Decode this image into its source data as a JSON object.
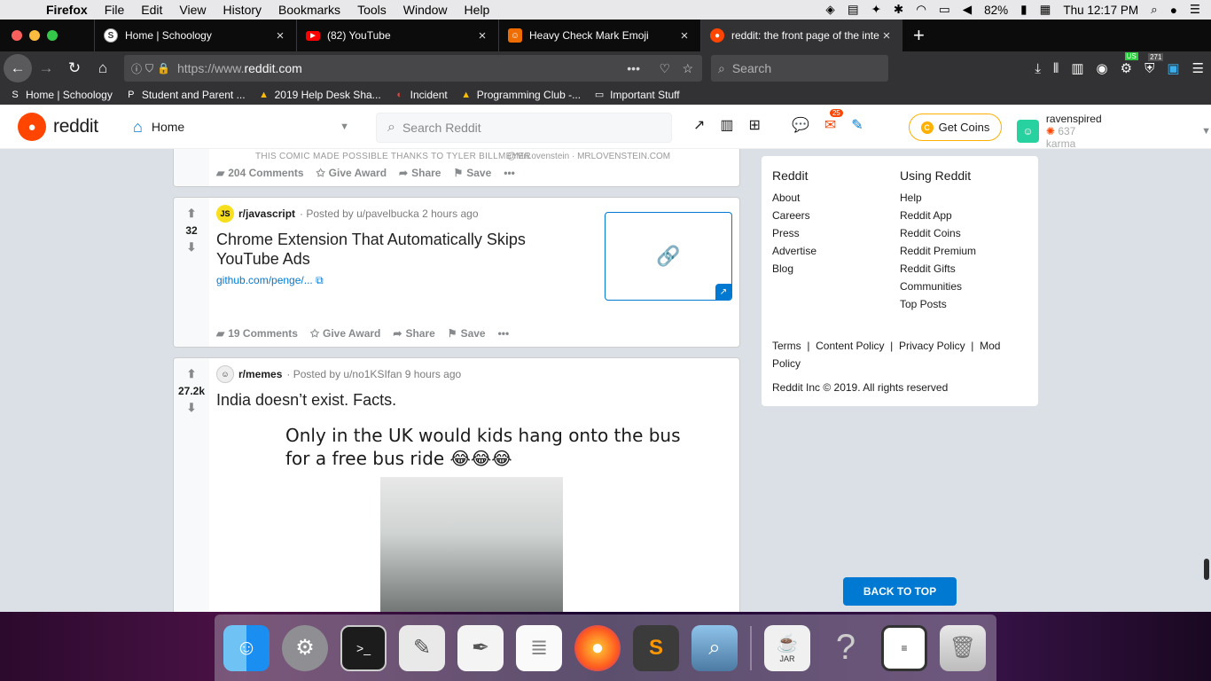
{
  "menubar": {
    "app": "Firefox",
    "items": [
      "File",
      "Edit",
      "View",
      "History",
      "Bookmarks",
      "Tools",
      "Window",
      "Help"
    ],
    "battery": "82%",
    "clock": "Thu 12:17 PM"
  },
  "tabs": [
    {
      "title": "Home | Schoology",
      "icon": "schoology-icon"
    },
    {
      "title": "(82) YouTube",
      "icon": "youtube-icon"
    },
    {
      "title": "Heavy Check Mark Emoji",
      "icon": "emojipedia-icon"
    },
    {
      "title": "reddit: the front page of the internet",
      "icon": "reddit-icon"
    }
  ],
  "nav": {
    "url_prefix": "https://www.",
    "url_domain": "reddit.com",
    "search_placeholder": "Search",
    "badge_271": "271",
    "badge_us": "US"
  },
  "bookmarks": [
    {
      "label": "Home | Schoology",
      "icon": "S"
    },
    {
      "label": "Student and Parent ...",
      "icon": "P"
    },
    {
      "label": "2019 Help Desk Sha...",
      "icon": "▲"
    },
    {
      "label": "Incident",
      "icon": "◐"
    },
    {
      "label": "Programming Club -...",
      "icon": "▲"
    },
    {
      "label": "Important Stuff",
      "icon": "▭"
    }
  ],
  "reddit_header": {
    "logo_text": "reddit",
    "feed": "Home",
    "search_placeholder": "Search Reddit",
    "mail_badge": "25",
    "get_coins": "Get Coins",
    "username": "ravenspired",
    "karma": "637 karma"
  },
  "posts": [
    {
      "partial_caption": "THIS COMIC MADE POSSIBLE THANKS TO TYLER BILLMEYER",
      "partial_credit": "@MrLovenstein · MRLOVENSTEIN.COM",
      "comments": "204 Comments",
      "award": "Give Award",
      "share": "Share",
      "save": "Save"
    },
    {
      "votes": "32",
      "sub_icon": "JS",
      "subreddit": "r/javascript",
      "posted_by": "· Posted by u/pavelbucka 2 hours ago",
      "title": "Chrome Extension That Automatically Skips YouTube Ads",
      "link": "github.com/penge/...",
      "comments": "19 Comments",
      "award": "Give Award",
      "share": "Share",
      "save": "Save"
    },
    {
      "votes": "27.2k",
      "subreddit": "r/memes",
      "posted_by": "· Posted by u/no1KSIfan 9 hours ago",
      "title": "India doesn’t exist. Facts.",
      "meme_line1": "Only in the UK would kids hang onto the bus",
      "meme_line2": "for a free bus ride 😂😂😂"
    }
  ],
  "sidebar": {
    "col1_title": "Reddit",
    "col1": [
      "About",
      "Careers",
      "Press",
      "Advertise",
      "Blog"
    ],
    "col2_title": "Using Reddit",
    "col2": [
      "Help",
      "Reddit App",
      "Reddit Coins",
      "Reddit Premium",
      "Reddit Gifts",
      "Communities",
      "Top Posts"
    ],
    "legal": "Terms  |  Content Policy  |  Privacy Policy  |  Mod Policy",
    "copyright": "Reddit Inc © 2019. All rights reserved"
  },
  "back_to_top": "BACK TO TOP",
  "dock": [
    "finder-icon",
    "system-preferences-icon",
    "terminal-icon",
    "script-editor-icon",
    "textedit-icon",
    "notes-icon",
    "firefox-icon",
    "sublime-text-icon",
    "preview-icon",
    "jar-launcher-icon",
    "help-icon",
    "console-icon",
    "trash-icon"
  ],
  "dock_jar_label": "JAR"
}
